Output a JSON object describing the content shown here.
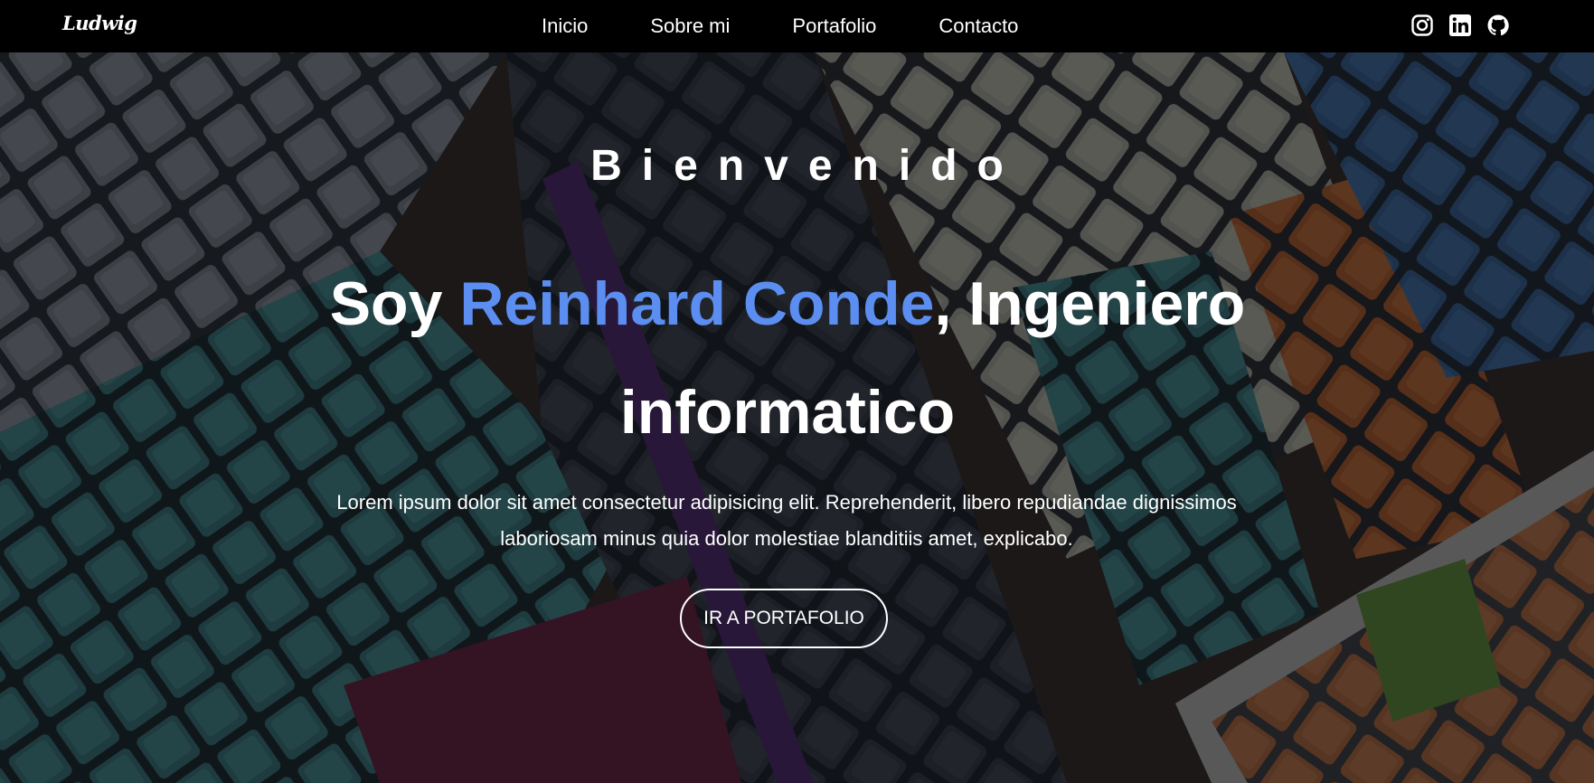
{
  "navbar": {
    "brand": "Ludwig",
    "links": [
      {
        "label": "Inicio"
      },
      {
        "label": "Sobre mi"
      },
      {
        "label": "Portafolio"
      },
      {
        "label": "Contacto"
      }
    ],
    "social_icons": [
      "instagram-icon",
      "linkedin-icon",
      "github-icon"
    ]
  },
  "hero": {
    "greeting": "Bienvenido",
    "headline_prefix": "Soy ",
    "headline_name": "Reinhard Conde",
    "headline_suffix": ", Ingeniero informatico",
    "description": "Lorem ipsum dolor sit amet consectetur adipisicing elit. Reprehenderit, libero repudiandae dignissimos laboriosam minus quia dolor molestiae blanditiis amet, explicabo.",
    "cta_label": "IR A PORTAFOLIO",
    "background_image": "keyboards-photo"
  },
  "colors": {
    "navbar_bg": "#000000",
    "accent": "#5b8ef0",
    "text": "#ffffff"
  }
}
